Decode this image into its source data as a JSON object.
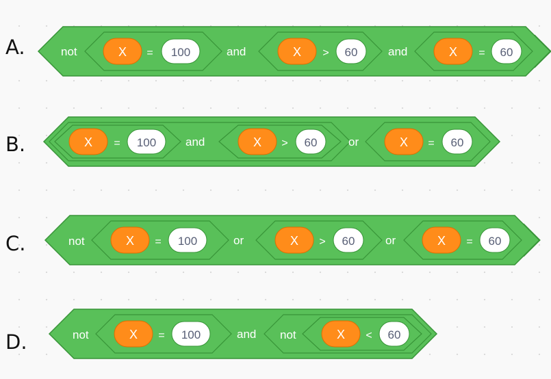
{
  "colors": {
    "operator_green": "#59c059",
    "operator_green_dark": "#389438",
    "variable_orange": "#ff8c1a",
    "variable_orange_dark": "#db6e00",
    "reporter_white": "#ffffff",
    "text_white": "#ffffff",
    "text_dark": "#575e75"
  },
  "options": [
    {
      "label": "A.",
      "parts": [
        {
          "kind": "kw",
          "text": "not"
        },
        {
          "kind": "cmp",
          "var": "X",
          "op": "=",
          "num": "100"
        },
        {
          "kind": "kw",
          "text": "and"
        },
        {
          "kind": "cmp",
          "var": "X",
          "op": ">",
          "num": "60"
        },
        {
          "kind": "kw",
          "text": "and"
        },
        {
          "kind": "cmp",
          "var": "X",
          "op": "=",
          "num": "60"
        }
      ]
    },
    {
      "label": "B.",
      "parts": [
        {
          "kind": "cmp",
          "var": "X",
          "op": "=",
          "num": "100"
        },
        {
          "kind": "kw",
          "text": "and"
        },
        {
          "kind": "cmp",
          "var": "X",
          "op": ">",
          "num": "60"
        },
        {
          "kind": "kw",
          "text": "or"
        },
        {
          "kind": "cmp",
          "var": "X",
          "op": "=",
          "num": "60"
        }
      ]
    },
    {
      "label": "C.",
      "parts": [
        {
          "kind": "kw",
          "text": "not"
        },
        {
          "kind": "cmp",
          "var": "X",
          "op": "=",
          "num": "100"
        },
        {
          "kind": "kw",
          "text": "or"
        },
        {
          "kind": "cmp",
          "var": "X",
          "op": ">",
          "num": "60"
        },
        {
          "kind": "kw",
          "text": "or"
        },
        {
          "kind": "cmp",
          "var": "X",
          "op": "=",
          "num": "60"
        }
      ]
    },
    {
      "label": "D.",
      "parts": [
        {
          "kind": "kw",
          "text": "not"
        },
        {
          "kind": "cmp",
          "var": "X",
          "op": "=",
          "num": "100"
        },
        {
          "kind": "kw",
          "text": "and"
        },
        {
          "kind": "kw",
          "text": "not"
        },
        {
          "kind": "cmp",
          "var": "X",
          "op": "<",
          "num": "60"
        }
      ]
    }
  ]
}
